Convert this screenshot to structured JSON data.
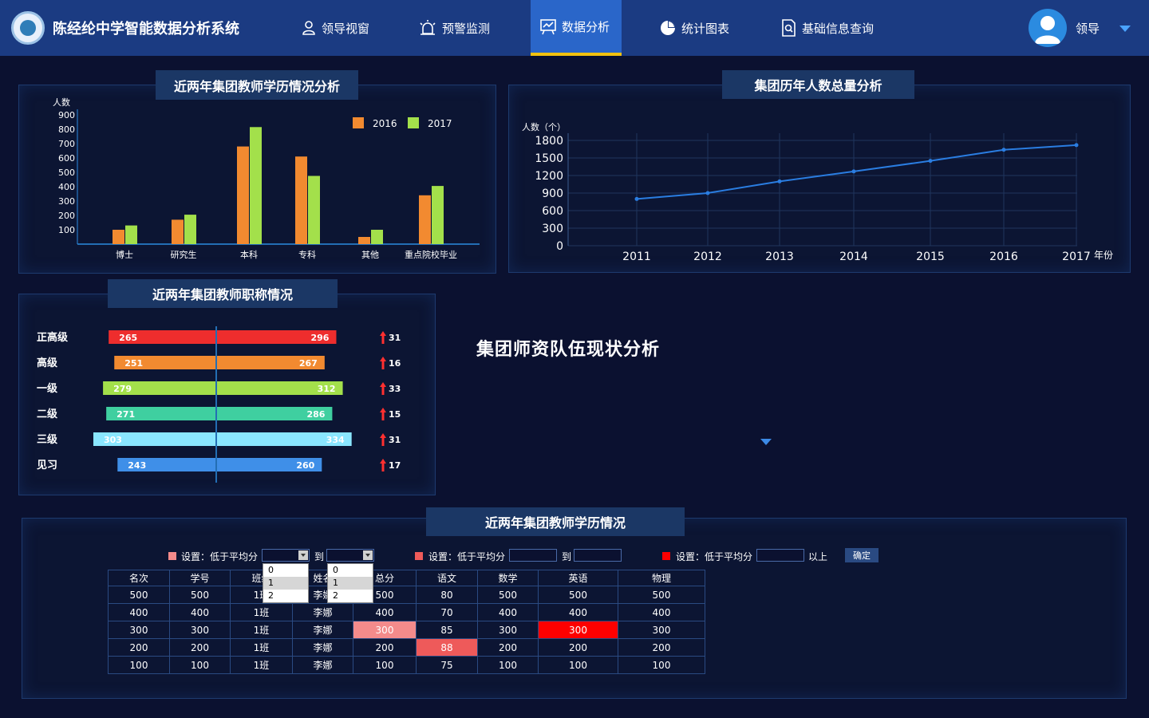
{
  "app": {
    "title": "陈经纶中学智能数据分析系统"
  },
  "nav": {
    "items": [
      {
        "label": "领导视窗",
        "icon": "person-icon"
      },
      {
        "label": "预警监测",
        "icon": "alarm-icon"
      },
      {
        "label": "数据分析",
        "icon": "analysis-icon",
        "active": true
      },
      {
        "label": "统计图表",
        "icon": "pie-chart-icon"
      },
      {
        "label": "基础信息查询",
        "icon": "document-search-icon"
      }
    ]
  },
  "user": {
    "name": "领导"
  },
  "panels": {
    "education": {
      "title": "近两年集团教师学历情况分析"
    },
    "headcount": {
      "title": "集团历年人数总量分析"
    },
    "titles": {
      "title": "近两年集团教师职称情况"
    },
    "table": {
      "title": "近两年集团教师学历情况"
    }
  },
  "section_heading": "集团师资队伍现状分析",
  "chart_data": [
    {
      "type": "bar",
      "title": "近两年集团教师学历情况分析",
      "ylabel": "人数",
      "ylim": [
        0,
        900
      ],
      "yticks": [
        100,
        200,
        300,
        400,
        500,
        600,
        700,
        800,
        900
      ],
      "categories": [
        "博士",
        "研究生",
        "本科",
        "专科",
        "其他",
        "重点院校毕业"
      ],
      "series": [
        {
          "name": "2016",
          "color": "#f28a30",
          "values": [
            100,
            170,
            680,
            610,
            50,
            340
          ]
        },
        {
          "name": "2017",
          "color": "#a3e04b",
          "values": [
            130,
            205,
            815,
            475,
            100,
            405
          ]
        }
      ],
      "legend": "top-right"
    },
    {
      "type": "line",
      "title": "集团历年人数总量分析",
      "ylabel": "人数（个）",
      "xlabel": "年份",
      "ylim": [
        0,
        1800
      ],
      "yticks": [
        0,
        300,
        600,
        900,
        1200,
        1500,
        1800
      ],
      "x": [
        "2011",
        "2012",
        "2013",
        "2014",
        "2015",
        "2016",
        "2017"
      ],
      "series": [
        {
          "name": "",
          "color": "#2a7de1",
          "values": [
            800,
            900,
            1100,
            1270,
            1450,
            1640,
            1720
          ]
        }
      ],
      "grid": true
    },
    {
      "type": "bar",
      "title": "近两年集团教师职称情况",
      "categories": [
        "正高级",
        "高级",
        "一级",
        "二级",
        "三级",
        "见习"
      ],
      "colors": [
        "#ee2d2d",
        "#f28a30",
        "#a3e04b",
        "#3fcfa0",
        "#8ae6ff",
        "#3f8fe8"
      ],
      "series": [
        {
          "name": "",
          "values": [
            265,
            251,
            279,
            271,
            303,
            243
          ]
        },
        {
          "name": "",
          "values": [
            296,
            267,
            312,
            286,
            334,
            260
          ]
        }
      ],
      "increase": [
        31,
        16,
        33,
        15,
        31,
        17
      ]
    }
  ],
  "filters": [
    {
      "label": "设置：低于平均分",
      "color": "#f48b8b",
      "to": "到",
      "options": [
        "0",
        "1",
        "2"
      ],
      "selected": "1"
    },
    {
      "label": "设置：低于平均分",
      "color": "#ee5a5a",
      "to": "到"
    },
    {
      "label": "设置：低于平均分",
      "color": "#ff0000",
      "suffix": "以上"
    }
  ],
  "confirm_label": "确定",
  "table": {
    "headers": [
      "名次",
      "学号",
      "班级",
      "姓名",
      "总分",
      "语文",
      "数学",
      "英语",
      "物理"
    ],
    "rows": [
      [
        "500",
        "500",
        "1班",
        "李娜",
        "500",
        "80",
        "500",
        "500",
        "500"
      ],
      [
        "400",
        "400",
        "1班",
        "李娜",
        "400",
        "70",
        "400",
        "400",
        "400"
      ],
      [
        "300",
        "300",
        "1班",
        "李娜",
        "300",
        "85",
        "300",
        "300",
        "300"
      ],
      [
        "200",
        "200",
        "1班",
        "李娜",
        "200",
        "88",
        "200",
        "200",
        "200"
      ],
      [
        "100",
        "100",
        "1班",
        "李娜",
        "100",
        "75",
        "100",
        "100",
        "100"
      ]
    ]
  }
}
